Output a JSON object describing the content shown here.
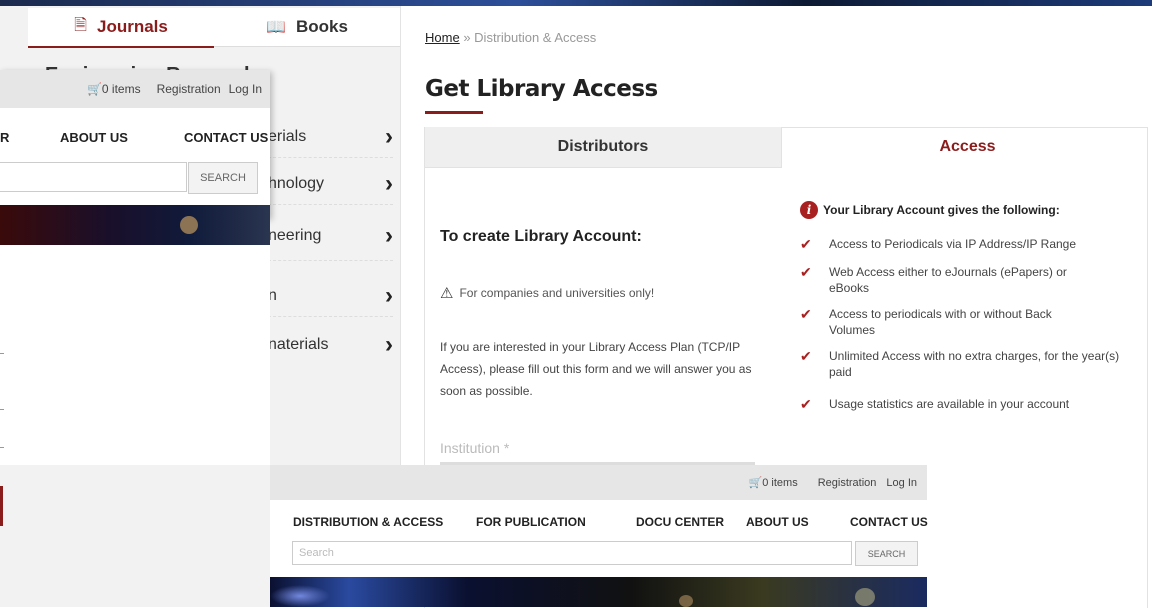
{
  "sidebar": {
    "tabs": [
      {
        "label": "Journals",
        "icon": "document-icon"
      },
      {
        "label": "Books",
        "icon": "book-icon"
      }
    ],
    "heading_fragment": "Engineering Research",
    "categories": [
      {
        "label": "erials"
      },
      {
        "label": "hnology"
      },
      {
        "label": "neering"
      },
      {
        "label": "n"
      },
      {
        "label": "naterials"
      }
    ]
  },
  "breadcrumb": {
    "home": "Home",
    "separator": "»",
    "current": "Distribution & Access"
  },
  "page": {
    "title": "Get Library Access"
  },
  "tabs": {
    "distributors": "Distributors",
    "access": "Access"
  },
  "access": {
    "heading": "To create Library Account:",
    "warning": "For companies and universities only!",
    "intro": "If you are interested in your Library Access Plan (TCP/IP Access), please fill out this form and we will answer you as soon as possible.",
    "institution_label": "Institution *",
    "benefits_title": "Your Library Account gives the following:",
    "benefits": [
      "Access to Periodicals via IP Address/IP Range",
      "Web Access either to eJournals (ePapers) or eBooks",
      "Access to periodicals with or without Back Volumes",
      "Unlimited Access with no extra charges, for the year(s) paid",
      "Usage statistics are available in your account"
    ]
  },
  "overlay_top": {
    "cart": "0 items",
    "registration": "Registration",
    "login": "Log In",
    "nav": [
      "R",
      "ABOUT US",
      "CONTACT US"
    ],
    "search_button": "SEARCH"
  },
  "overlay_bottom": {
    "cart": "0 items",
    "registration": "Registration",
    "login": "Log In",
    "nav": [
      "DISTRIBUTION & ACCESS",
      "FOR PUBLICATION",
      "DOCU CENTER",
      "ABOUT US",
      "CONTACT US"
    ],
    "search_placeholder": "Search",
    "search_button": "SEARCH"
  },
  "colors": {
    "accent": "#8b1c1c",
    "check": "#a82020"
  }
}
